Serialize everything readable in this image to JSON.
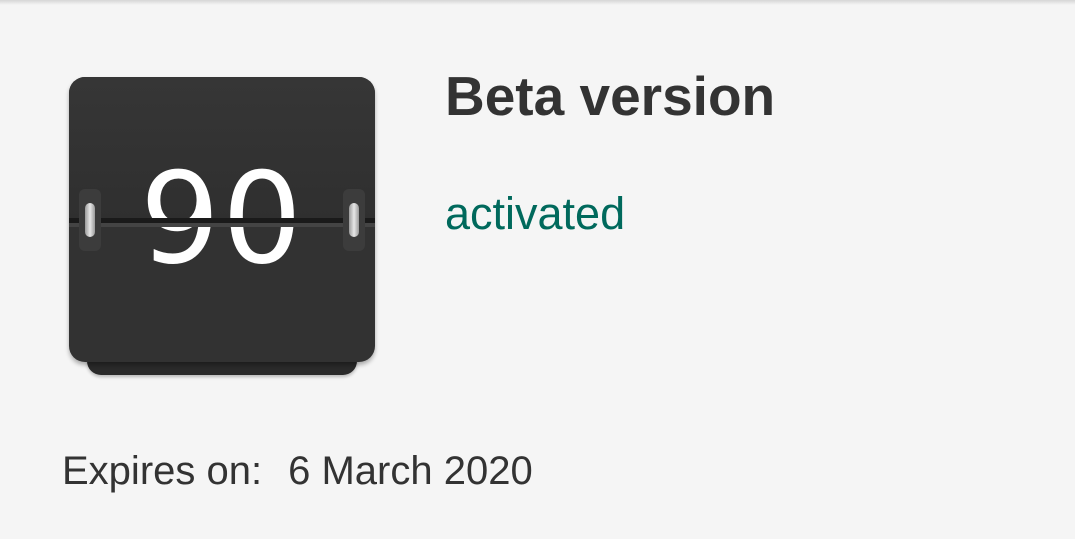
{
  "counter": {
    "value": "90",
    "color_card": "#323232",
    "color_digits": "#ffffff"
  },
  "title": "Beta version",
  "status": {
    "text": "activated",
    "color": "#00695c"
  },
  "expiry": {
    "label": "Expires on:",
    "date": "6 March 2020"
  }
}
